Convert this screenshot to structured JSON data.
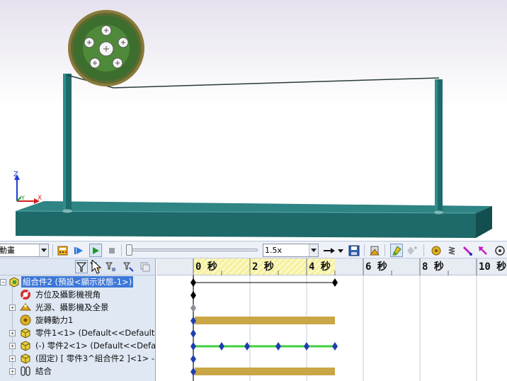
{
  "toolbar": {
    "study_type": "動畫",
    "playback_speed": "1.5x"
  },
  "timeline": {
    "current_time_s": 4,
    "ticks": [
      "0 秒",
      "2 秒",
      "4 秒",
      "6 秒",
      "8 秒",
      "10 秒"
    ]
  },
  "tree": {
    "items": [
      {
        "label": "組合件2 (預設<顯示狀態-1>)",
        "icon": "assembly-icon",
        "selected": true
      },
      {
        "label": "方位及攝影機視角",
        "icon": "orientation-icon"
      },
      {
        "label": "光源、攝影機及全景",
        "icon": "lights-icon"
      },
      {
        "label": "旋轉動力1",
        "icon": "motor-icon"
      },
      {
        "label": "零件1<1> (Default<<Default>",
        "icon": "part-icon"
      },
      {
        "label": "(-) 零件2<1> (Default<<Defau",
        "icon": "part-icon"
      },
      {
        "label": "(固定) [ 零件3^組合件2 ]<1> -:",
        "icon": "part-icon"
      },
      {
        "label": "結合",
        "icon": "mates-icon"
      }
    ]
  },
  "triad": {
    "z": "Z",
    "y": "Y",
    "x": "X"
  },
  "colors": {
    "model_teal": "#1d6b6b",
    "pulley_green": "#3c6e2e",
    "pulley_rim": "#8a7a3a",
    "time_bar": "#c9a646",
    "key_track": "#3fcf3f",
    "key_marker": "#1e3fb0",
    "selection": "#3d78d8"
  }
}
